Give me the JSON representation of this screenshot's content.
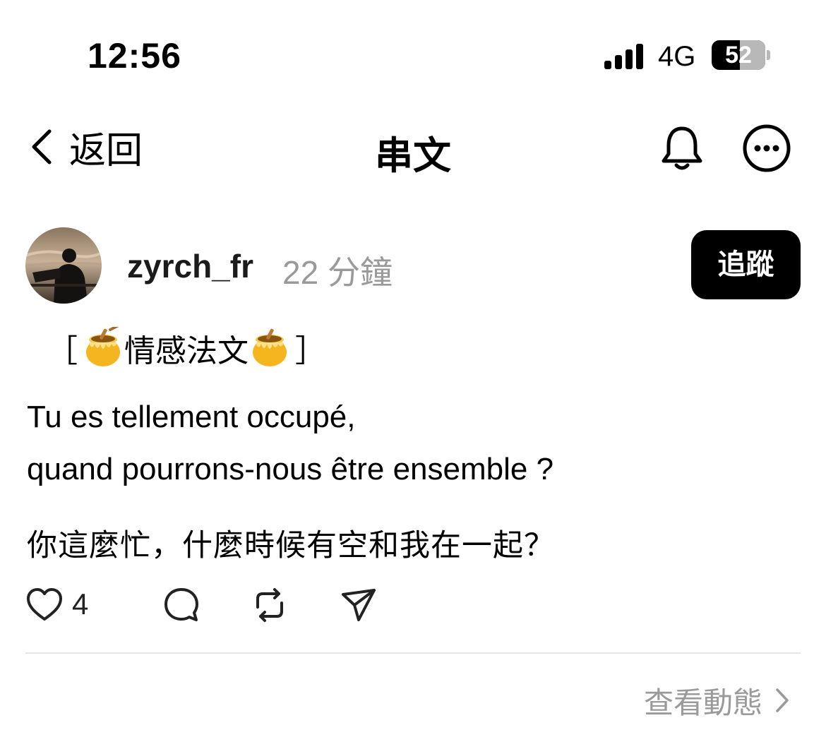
{
  "status_bar": {
    "time": "12:56",
    "network": "4G",
    "battery": "52"
  },
  "header": {
    "back_label": "返回",
    "title": "串文"
  },
  "post": {
    "username": "zyrch_fr",
    "timestamp": "22 分鐘",
    "follow_label": "追蹤",
    "tag_open": "［",
    "tag_text": "情感法文",
    "tag_close": "］",
    "line1": "Tu es tellement occupé,",
    "line2": "quand pourrons-nous être ensemble ?",
    "line3": "你這麼忙，什麼時候有空和我在一起？",
    "like_count": "4"
  },
  "footer": {
    "activity_label": "查看動態"
  },
  "colors": {
    "secondary_text": "#9a9a9a",
    "divider": "#e5e5e5",
    "follow_button": "#000000"
  }
}
